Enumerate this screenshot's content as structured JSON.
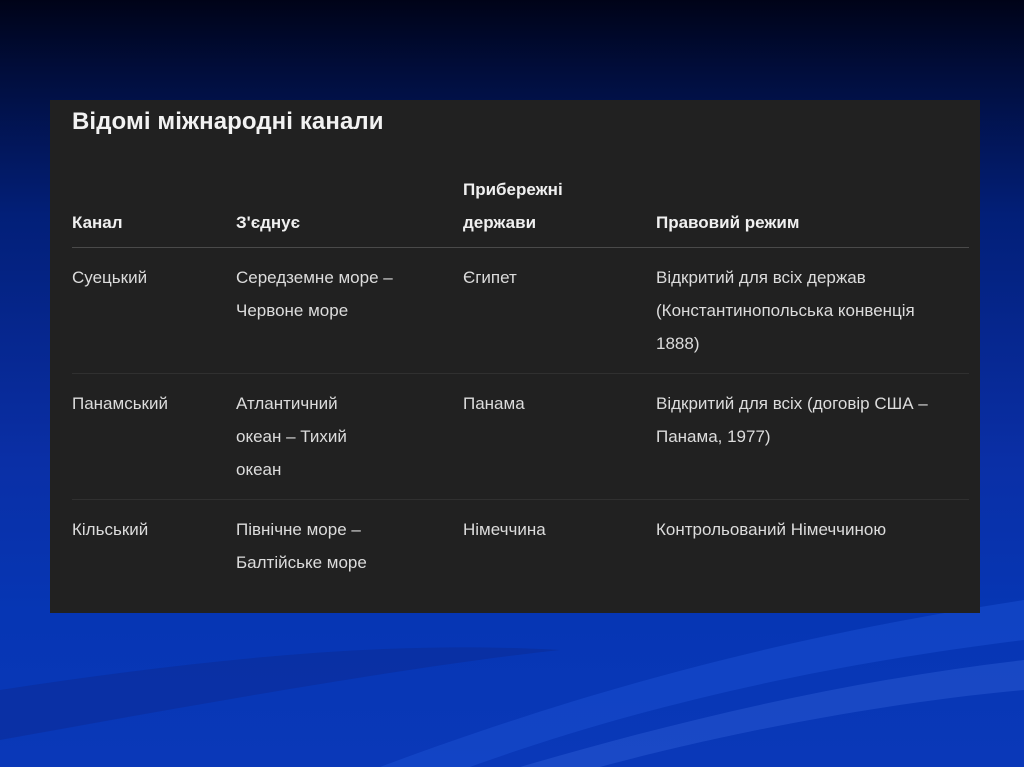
{
  "slide": {
    "title": "Відомі міжнародні канали"
  },
  "table": {
    "headers": [
      "Канал",
      "З'єднує",
      "Прибережні держави",
      "Правовий режим"
    ],
    "rows": [
      [
        "Суецький",
        "Середземне море – Червоне море",
        "Єгипет",
        "Відкритий для всіх держав (Константинопольська конвенція 1888)"
      ],
      [
        "Панамський",
        "Атлантичний океан – Тихий океан",
        "Панама",
        "Відкритий для всіх (договір США – Панама, 1977)"
      ],
      [
        "Кільський",
        "Північне море – Балтійське море",
        "Німеччина",
        "Контрольований Німеччиною"
      ]
    ]
  },
  "colors": {
    "panel_background": "#212121",
    "slide_background_top": "#000318",
    "slide_background_bottom": "#0a38b8"
  }
}
